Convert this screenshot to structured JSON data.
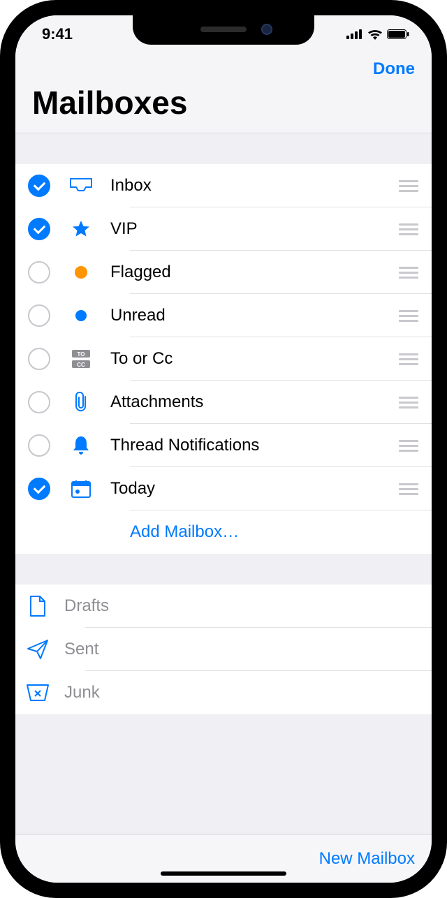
{
  "status": {
    "time": "9:41"
  },
  "nav": {
    "done": "Done",
    "title": "Mailboxes"
  },
  "mailboxes": [
    {
      "icon": "inbox",
      "label": "Inbox",
      "checked": true
    },
    {
      "icon": "star",
      "label": "VIP",
      "checked": true
    },
    {
      "icon": "flag-dot",
      "label": "Flagged",
      "checked": false
    },
    {
      "icon": "blue-dot",
      "label": "Unread",
      "checked": false
    },
    {
      "icon": "to-cc",
      "label": "To or Cc",
      "checked": false
    },
    {
      "icon": "paperclip",
      "label": "Attachments",
      "checked": false
    },
    {
      "icon": "bell",
      "label": "Thread Notifications",
      "checked": false
    },
    {
      "icon": "calendar",
      "label": "Today",
      "checked": true
    }
  ],
  "add_mailbox": "Add Mailbox…",
  "static_boxes": [
    {
      "icon": "doc",
      "label": "Drafts"
    },
    {
      "icon": "send",
      "label": "Sent"
    },
    {
      "icon": "junk",
      "label": "Junk"
    }
  ],
  "toolbar": {
    "new_mailbox": "New Mailbox"
  },
  "colors": {
    "link": "#007aff",
    "muted": "#8e8e93",
    "flag": "#ff9500"
  }
}
